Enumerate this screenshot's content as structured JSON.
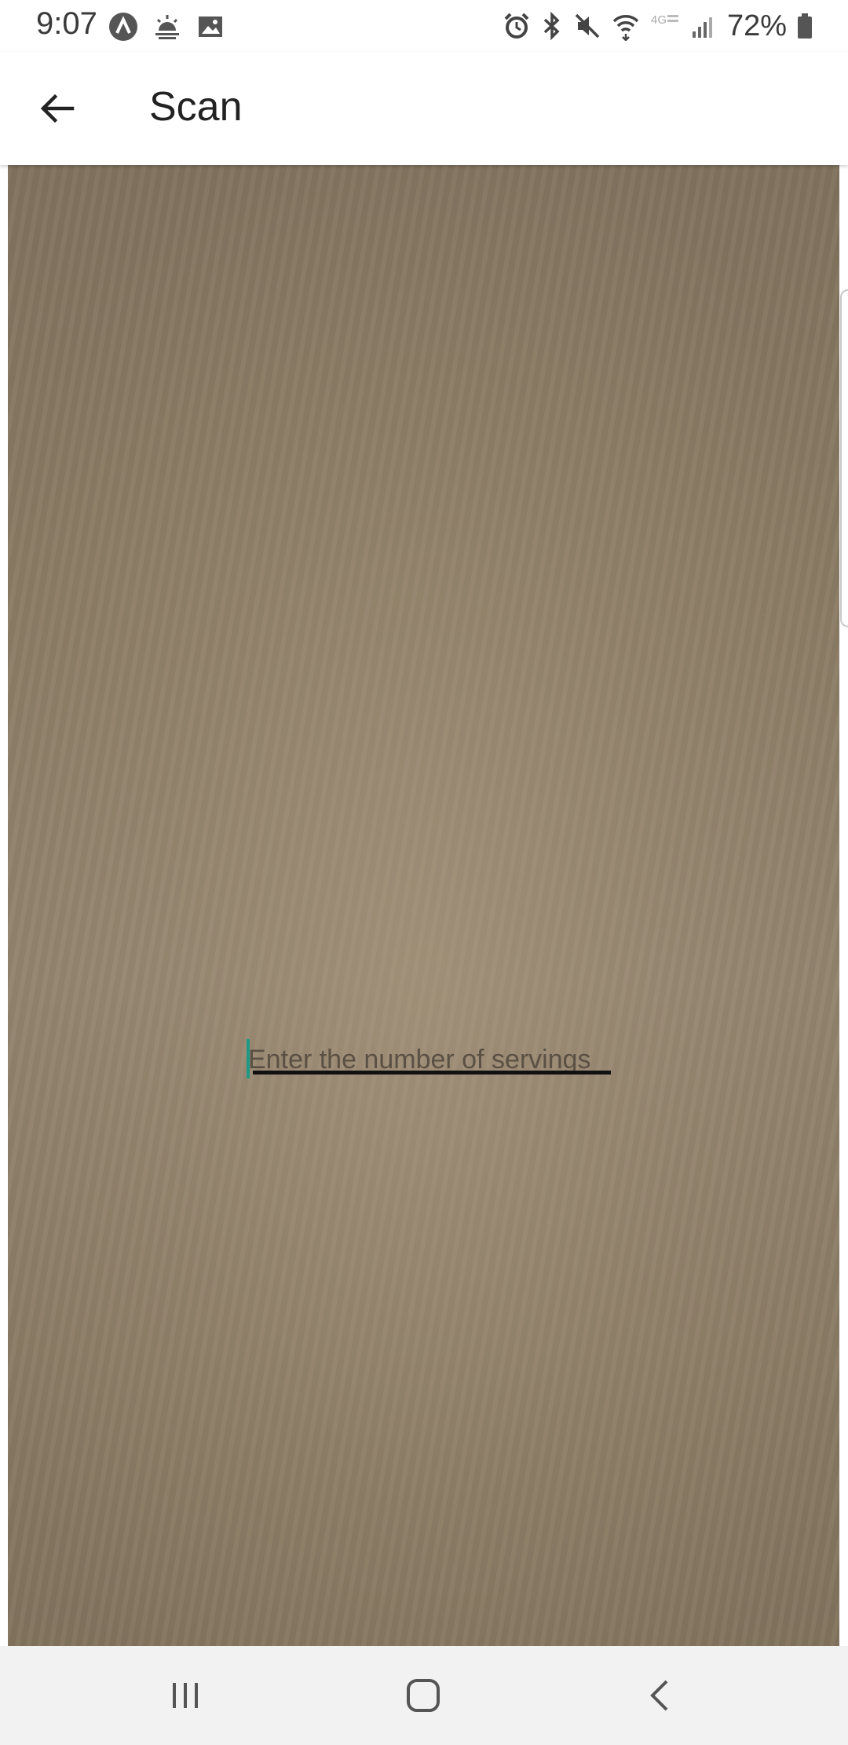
{
  "status_bar": {
    "time": "9:07",
    "battery": "72%",
    "left_icons": [
      "app-notification-icon",
      "weather-icon",
      "gallery-icon"
    ],
    "right_icons": [
      "alarm-icon",
      "bluetooth-icon",
      "mute-icon",
      "wifi-icon",
      "lte-icon",
      "signal-icon",
      "battery-icon"
    ]
  },
  "app_bar": {
    "title": "Scan",
    "back_icon": "arrow-back-icon"
  },
  "servings_input": {
    "value": "",
    "placeholder": "Enter the number of servings"
  },
  "nav_bar": {
    "icons": [
      "recent-apps-icon",
      "home-icon",
      "back-icon"
    ]
  },
  "colors": {
    "cursor": "#1d9a86",
    "preview_base": "#908069",
    "nav_background": "#f2f2f2"
  }
}
